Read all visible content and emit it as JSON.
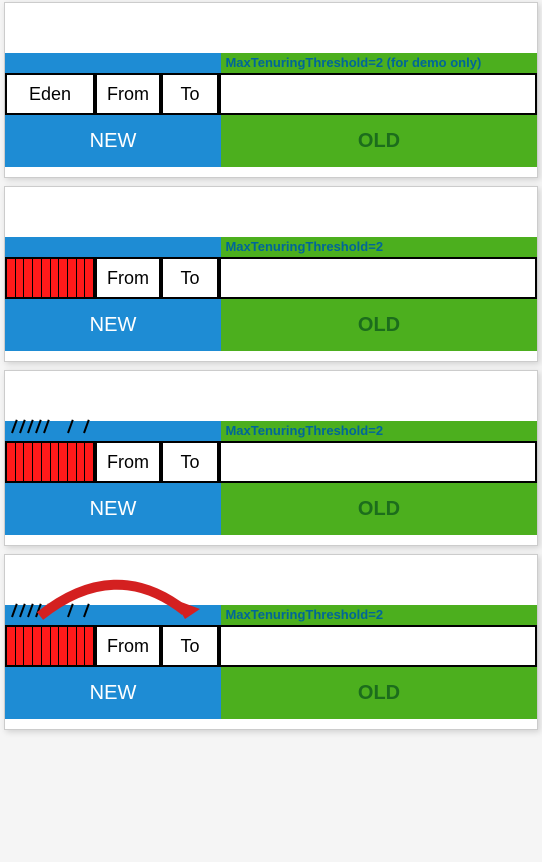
{
  "panels": [
    {
      "threshold_text": "MaxTenuringThreshold=2 (for demo only)",
      "eden_label": "Eden",
      "from_label": "From",
      "to_label": "To",
      "new_label": "NEW",
      "old_label": "OLD",
      "eden_filled": false,
      "gc_running": false,
      "show_arrow": false
    },
    {
      "threshold_text": "MaxTenuringThreshold=2",
      "eden_label": "",
      "from_label": "From",
      "to_label": "To",
      "new_label": "NEW",
      "old_label": "OLD",
      "eden_filled": true,
      "gc_running": false,
      "show_arrow": false
    },
    {
      "threshold_text": "MaxTenuringThreshold=2",
      "eden_label": "",
      "from_label": "From",
      "to_label": "To",
      "new_label": "NEW",
      "old_label": "OLD",
      "eden_filled": true,
      "gc_running": true,
      "show_arrow": false
    },
    {
      "threshold_text": "MaxTenuringThreshold=2",
      "eden_label": "",
      "from_label": "From",
      "to_label": "To",
      "new_label": "NEW",
      "old_label": "OLD",
      "eden_filled": true,
      "gc_running": true,
      "show_arrow": true
    }
  ]
}
